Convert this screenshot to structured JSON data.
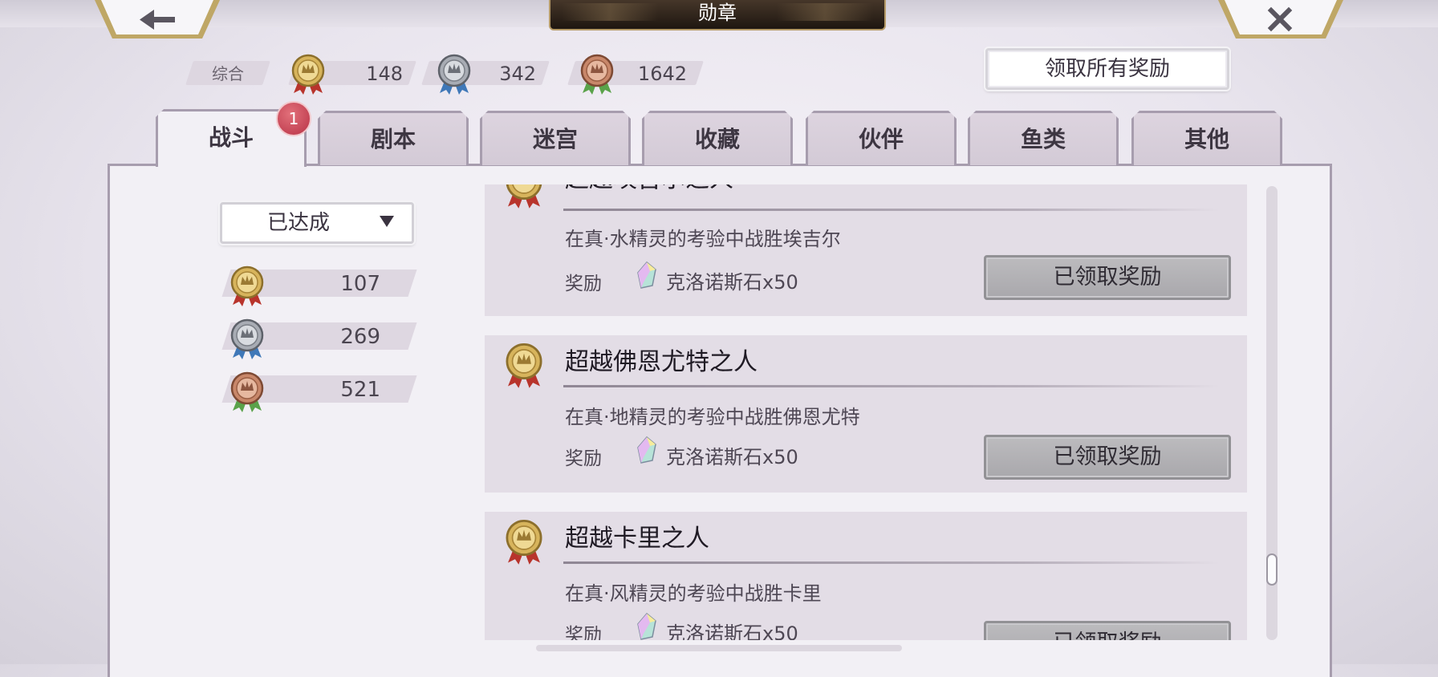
{
  "header": {
    "title": "勋章",
    "back_icon": "arrow-left-icon",
    "close_icon": "close-icon"
  },
  "summary": {
    "label": "综合",
    "gold": "148",
    "silver": "342",
    "bronze": "1642"
  },
  "claim_all_label": "领取所有奖励",
  "tabs": [
    {
      "label": "战斗",
      "active": true
    },
    {
      "label": "剧本"
    },
    {
      "label": "迷宫"
    },
    {
      "label": "收藏"
    },
    {
      "label": "伙伴"
    },
    {
      "label": "鱼类"
    },
    {
      "label": "其他"
    }
  ],
  "tab_badge": "1",
  "filter": {
    "selected": "已达成"
  },
  "category_counts": {
    "gold": "107",
    "silver": "269",
    "bronze": "521"
  },
  "medals": [
    {
      "name": "超越埃吉尔之人",
      "desc": "在真·水精灵的考验中战胜埃吉尔",
      "reward_label": "奖励",
      "reward": "克洛诺斯石x50",
      "button": "已领取奖励"
    },
    {
      "name": "超越佛恩尤特之人",
      "desc": "在真·地精灵的考验中战胜佛恩尤特",
      "reward_label": "奖励",
      "reward": "克洛诺斯石x50",
      "button": "已领取奖励"
    },
    {
      "name": "超越卡里之人",
      "desc": "在真·风精灵的考验中战胜卡里",
      "reward_label": "奖励",
      "reward": "克洛诺斯石x50",
      "button": "已领取奖励"
    }
  ],
  "colors": {
    "gold": "#d7b45c",
    "silver": "#a8acb4",
    "bronze": "#c8876a",
    "ribbon_red": "#b8342c",
    "ribbon_blue": "#3f78b8",
    "ribbon_green": "#5aa24a"
  }
}
